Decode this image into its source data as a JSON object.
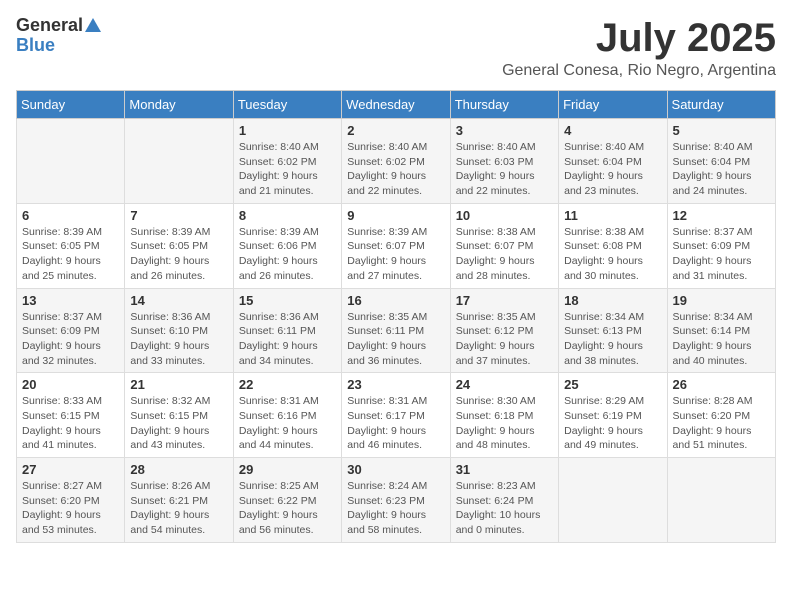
{
  "logo": {
    "general": "General",
    "blue": "Blue"
  },
  "title": "July 2025",
  "subtitle": "General Conesa, Rio Negro, Argentina",
  "days_of_week": [
    "Sunday",
    "Monday",
    "Tuesday",
    "Wednesday",
    "Thursday",
    "Friday",
    "Saturday"
  ],
  "weeks": [
    [
      {
        "day": "",
        "details": ""
      },
      {
        "day": "",
        "details": ""
      },
      {
        "day": "1",
        "details": "Sunrise: 8:40 AM\nSunset: 6:02 PM\nDaylight: 9 hours\nand 21 minutes."
      },
      {
        "day": "2",
        "details": "Sunrise: 8:40 AM\nSunset: 6:02 PM\nDaylight: 9 hours\nand 22 minutes."
      },
      {
        "day": "3",
        "details": "Sunrise: 8:40 AM\nSunset: 6:03 PM\nDaylight: 9 hours\nand 22 minutes."
      },
      {
        "day": "4",
        "details": "Sunrise: 8:40 AM\nSunset: 6:04 PM\nDaylight: 9 hours\nand 23 minutes."
      },
      {
        "day": "5",
        "details": "Sunrise: 8:40 AM\nSunset: 6:04 PM\nDaylight: 9 hours\nand 24 minutes."
      }
    ],
    [
      {
        "day": "6",
        "details": "Sunrise: 8:39 AM\nSunset: 6:05 PM\nDaylight: 9 hours\nand 25 minutes."
      },
      {
        "day": "7",
        "details": "Sunrise: 8:39 AM\nSunset: 6:05 PM\nDaylight: 9 hours\nand 26 minutes."
      },
      {
        "day": "8",
        "details": "Sunrise: 8:39 AM\nSunset: 6:06 PM\nDaylight: 9 hours\nand 26 minutes."
      },
      {
        "day": "9",
        "details": "Sunrise: 8:39 AM\nSunset: 6:07 PM\nDaylight: 9 hours\nand 27 minutes."
      },
      {
        "day": "10",
        "details": "Sunrise: 8:38 AM\nSunset: 6:07 PM\nDaylight: 9 hours\nand 28 minutes."
      },
      {
        "day": "11",
        "details": "Sunrise: 8:38 AM\nSunset: 6:08 PM\nDaylight: 9 hours\nand 30 minutes."
      },
      {
        "day": "12",
        "details": "Sunrise: 8:37 AM\nSunset: 6:09 PM\nDaylight: 9 hours\nand 31 minutes."
      }
    ],
    [
      {
        "day": "13",
        "details": "Sunrise: 8:37 AM\nSunset: 6:09 PM\nDaylight: 9 hours\nand 32 minutes."
      },
      {
        "day": "14",
        "details": "Sunrise: 8:36 AM\nSunset: 6:10 PM\nDaylight: 9 hours\nand 33 minutes."
      },
      {
        "day": "15",
        "details": "Sunrise: 8:36 AM\nSunset: 6:11 PM\nDaylight: 9 hours\nand 34 minutes."
      },
      {
        "day": "16",
        "details": "Sunrise: 8:35 AM\nSunset: 6:11 PM\nDaylight: 9 hours\nand 36 minutes."
      },
      {
        "day": "17",
        "details": "Sunrise: 8:35 AM\nSunset: 6:12 PM\nDaylight: 9 hours\nand 37 minutes."
      },
      {
        "day": "18",
        "details": "Sunrise: 8:34 AM\nSunset: 6:13 PM\nDaylight: 9 hours\nand 38 minutes."
      },
      {
        "day": "19",
        "details": "Sunrise: 8:34 AM\nSunset: 6:14 PM\nDaylight: 9 hours\nand 40 minutes."
      }
    ],
    [
      {
        "day": "20",
        "details": "Sunrise: 8:33 AM\nSunset: 6:15 PM\nDaylight: 9 hours\nand 41 minutes."
      },
      {
        "day": "21",
        "details": "Sunrise: 8:32 AM\nSunset: 6:15 PM\nDaylight: 9 hours\nand 43 minutes."
      },
      {
        "day": "22",
        "details": "Sunrise: 8:31 AM\nSunset: 6:16 PM\nDaylight: 9 hours\nand 44 minutes."
      },
      {
        "day": "23",
        "details": "Sunrise: 8:31 AM\nSunset: 6:17 PM\nDaylight: 9 hours\nand 46 minutes."
      },
      {
        "day": "24",
        "details": "Sunrise: 8:30 AM\nSunset: 6:18 PM\nDaylight: 9 hours\nand 48 minutes."
      },
      {
        "day": "25",
        "details": "Sunrise: 8:29 AM\nSunset: 6:19 PM\nDaylight: 9 hours\nand 49 minutes."
      },
      {
        "day": "26",
        "details": "Sunrise: 8:28 AM\nSunset: 6:20 PM\nDaylight: 9 hours\nand 51 minutes."
      }
    ],
    [
      {
        "day": "27",
        "details": "Sunrise: 8:27 AM\nSunset: 6:20 PM\nDaylight: 9 hours\nand 53 minutes."
      },
      {
        "day": "28",
        "details": "Sunrise: 8:26 AM\nSunset: 6:21 PM\nDaylight: 9 hours\nand 54 minutes."
      },
      {
        "day": "29",
        "details": "Sunrise: 8:25 AM\nSunset: 6:22 PM\nDaylight: 9 hours\nand 56 minutes."
      },
      {
        "day": "30",
        "details": "Sunrise: 8:24 AM\nSunset: 6:23 PM\nDaylight: 9 hours\nand 58 minutes."
      },
      {
        "day": "31",
        "details": "Sunrise: 8:23 AM\nSunset: 6:24 PM\nDaylight: 10 hours\nand 0 minutes."
      },
      {
        "day": "",
        "details": ""
      },
      {
        "day": "",
        "details": ""
      }
    ]
  ]
}
